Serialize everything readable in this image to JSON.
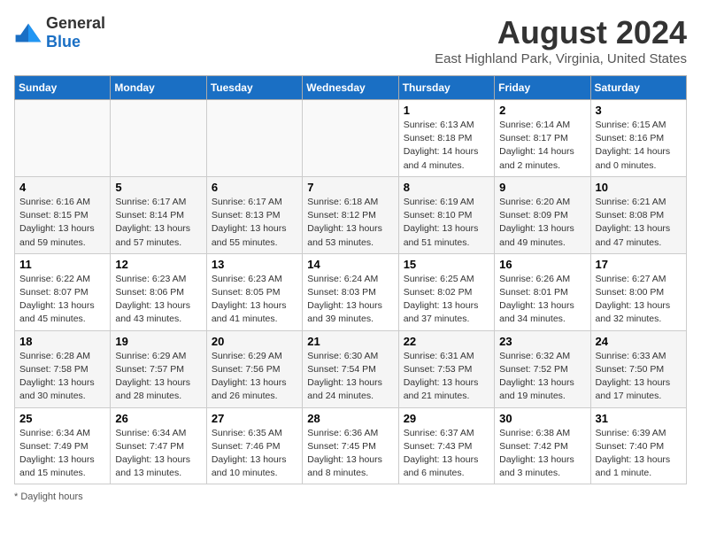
{
  "header": {
    "logo_general": "General",
    "logo_blue": "Blue",
    "title": "August 2024",
    "subtitle": "East Highland Park, Virginia, United States"
  },
  "calendar": {
    "days_of_week": [
      "Sunday",
      "Monday",
      "Tuesday",
      "Wednesday",
      "Thursday",
      "Friday",
      "Saturday"
    ],
    "weeks": [
      [
        {
          "day": "",
          "info": ""
        },
        {
          "day": "",
          "info": ""
        },
        {
          "day": "",
          "info": ""
        },
        {
          "day": "",
          "info": ""
        },
        {
          "day": "1",
          "info": "Sunrise: 6:13 AM\nSunset: 8:18 PM\nDaylight: 14 hours\nand 4 minutes."
        },
        {
          "day": "2",
          "info": "Sunrise: 6:14 AM\nSunset: 8:17 PM\nDaylight: 14 hours\nand 2 minutes."
        },
        {
          "day": "3",
          "info": "Sunrise: 6:15 AM\nSunset: 8:16 PM\nDaylight: 14 hours\nand 0 minutes."
        }
      ],
      [
        {
          "day": "4",
          "info": "Sunrise: 6:16 AM\nSunset: 8:15 PM\nDaylight: 13 hours\nand 59 minutes."
        },
        {
          "day": "5",
          "info": "Sunrise: 6:17 AM\nSunset: 8:14 PM\nDaylight: 13 hours\nand 57 minutes."
        },
        {
          "day": "6",
          "info": "Sunrise: 6:17 AM\nSunset: 8:13 PM\nDaylight: 13 hours\nand 55 minutes."
        },
        {
          "day": "7",
          "info": "Sunrise: 6:18 AM\nSunset: 8:12 PM\nDaylight: 13 hours\nand 53 minutes."
        },
        {
          "day": "8",
          "info": "Sunrise: 6:19 AM\nSunset: 8:10 PM\nDaylight: 13 hours\nand 51 minutes."
        },
        {
          "day": "9",
          "info": "Sunrise: 6:20 AM\nSunset: 8:09 PM\nDaylight: 13 hours\nand 49 minutes."
        },
        {
          "day": "10",
          "info": "Sunrise: 6:21 AM\nSunset: 8:08 PM\nDaylight: 13 hours\nand 47 minutes."
        }
      ],
      [
        {
          "day": "11",
          "info": "Sunrise: 6:22 AM\nSunset: 8:07 PM\nDaylight: 13 hours\nand 45 minutes."
        },
        {
          "day": "12",
          "info": "Sunrise: 6:23 AM\nSunset: 8:06 PM\nDaylight: 13 hours\nand 43 minutes."
        },
        {
          "day": "13",
          "info": "Sunrise: 6:23 AM\nSunset: 8:05 PM\nDaylight: 13 hours\nand 41 minutes."
        },
        {
          "day": "14",
          "info": "Sunrise: 6:24 AM\nSunset: 8:03 PM\nDaylight: 13 hours\nand 39 minutes."
        },
        {
          "day": "15",
          "info": "Sunrise: 6:25 AM\nSunset: 8:02 PM\nDaylight: 13 hours\nand 37 minutes."
        },
        {
          "day": "16",
          "info": "Sunrise: 6:26 AM\nSunset: 8:01 PM\nDaylight: 13 hours\nand 34 minutes."
        },
        {
          "day": "17",
          "info": "Sunrise: 6:27 AM\nSunset: 8:00 PM\nDaylight: 13 hours\nand 32 minutes."
        }
      ],
      [
        {
          "day": "18",
          "info": "Sunrise: 6:28 AM\nSunset: 7:58 PM\nDaylight: 13 hours\nand 30 minutes."
        },
        {
          "day": "19",
          "info": "Sunrise: 6:29 AM\nSunset: 7:57 PM\nDaylight: 13 hours\nand 28 minutes."
        },
        {
          "day": "20",
          "info": "Sunrise: 6:29 AM\nSunset: 7:56 PM\nDaylight: 13 hours\nand 26 minutes."
        },
        {
          "day": "21",
          "info": "Sunrise: 6:30 AM\nSunset: 7:54 PM\nDaylight: 13 hours\nand 24 minutes."
        },
        {
          "day": "22",
          "info": "Sunrise: 6:31 AM\nSunset: 7:53 PM\nDaylight: 13 hours\nand 21 minutes."
        },
        {
          "day": "23",
          "info": "Sunrise: 6:32 AM\nSunset: 7:52 PM\nDaylight: 13 hours\nand 19 minutes."
        },
        {
          "day": "24",
          "info": "Sunrise: 6:33 AM\nSunset: 7:50 PM\nDaylight: 13 hours\nand 17 minutes."
        }
      ],
      [
        {
          "day": "25",
          "info": "Sunrise: 6:34 AM\nSunset: 7:49 PM\nDaylight: 13 hours\nand 15 minutes."
        },
        {
          "day": "26",
          "info": "Sunrise: 6:34 AM\nSunset: 7:47 PM\nDaylight: 13 hours\nand 13 minutes."
        },
        {
          "day": "27",
          "info": "Sunrise: 6:35 AM\nSunset: 7:46 PM\nDaylight: 13 hours\nand 10 minutes."
        },
        {
          "day": "28",
          "info": "Sunrise: 6:36 AM\nSunset: 7:45 PM\nDaylight: 13 hours\nand 8 minutes."
        },
        {
          "day": "29",
          "info": "Sunrise: 6:37 AM\nSunset: 7:43 PM\nDaylight: 13 hours\nand 6 minutes."
        },
        {
          "day": "30",
          "info": "Sunrise: 6:38 AM\nSunset: 7:42 PM\nDaylight: 13 hours\nand 3 minutes."
        },
        {
          "day": "31",
          "info": "Sunrise: 6:39 AM\nSunset: 7:40 PM\nDaylight: 13 hours\nand 1 minute."
        }
      ]
    ]
  },
  "footer": {
    "note": "Daylight hours"
  }
}
